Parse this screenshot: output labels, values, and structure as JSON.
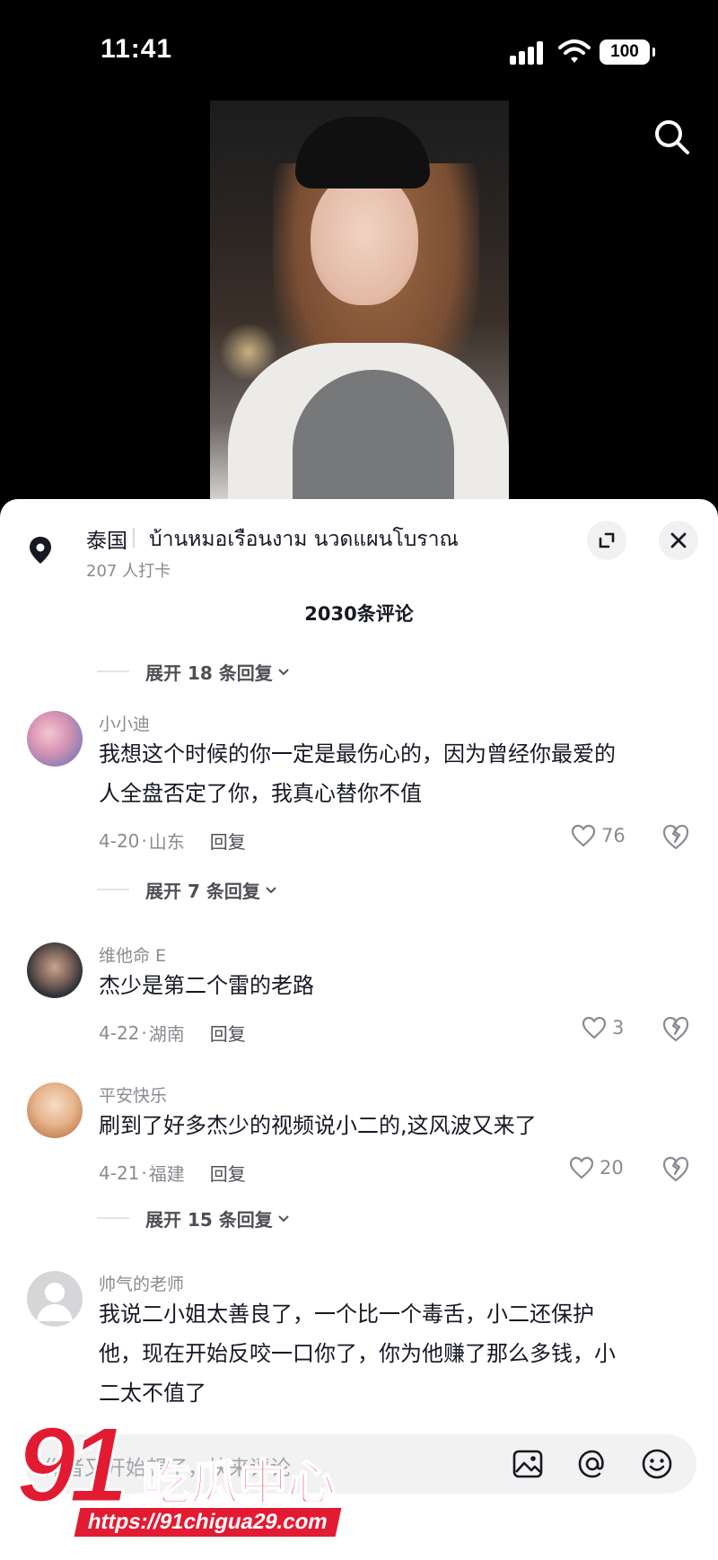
{
  "status_bar": {
    "time": "11:41",
    "battery": "100"
  },
  "location": {
    "country": "泰国",
    "name": "บ้านหมอเรือนงาม นวดแผนโบราณ",
    "checkins": "207 人打卡"
  },
  "comment_count": "2030条评论",
  "top_reply_expander": "展开 18 条回复",
  "comments": [
    {
      "user": "小小迪",
      "lines": [
        "我想这个时候的你一定是最伤心的，因为曾经你最爱的",
        "人全盘否定了你，我真心替你不值"
      ],
      "date": "4-20",
      "region": "山东",
      "reply_label": "回复",
      "likes": "76",
      "expander": "展开 7 条回复"
    },
    {
      "user": "维他命 E",
      "lines": [
        "杰少是第二个雷的老路"
      ],
      "date": "4-22",
      "region": "湖南",
      "reply_label": "回复",
      "likes": "3"
    },
    {
      "user": "平安快乐",
      "lines": [
        "刷到了好多杰少的视频说小二的,这风波又来了"
      ],
      "date": "4-21",
      "region": "福建",
      "reply_label": "回复",
      "likes": "20",
      "expander": "展开 15 条回复"
    },
    {
      "user": "帅气的老师",
      "lines": [
        "我说二小姐太善良了，一个比一个毒舌，小二还保护",
        "他，现在开始反咬一口你了，你为他赚了那么多钱，小",
        "二太不值了"
      ]
    }
  ],
  "input": {
    "placeholder": "作者又开始想了，快来评论"
  },
  "watermark": {
    "number": "91",
    "brand": "吃瓜中心",
    "url": "https://91chigua29.com"
  },
  "colors": {
    "accent": "#e21b32",
    "text": "#161823",
    "muted": "#8a8b91"
  }
}
